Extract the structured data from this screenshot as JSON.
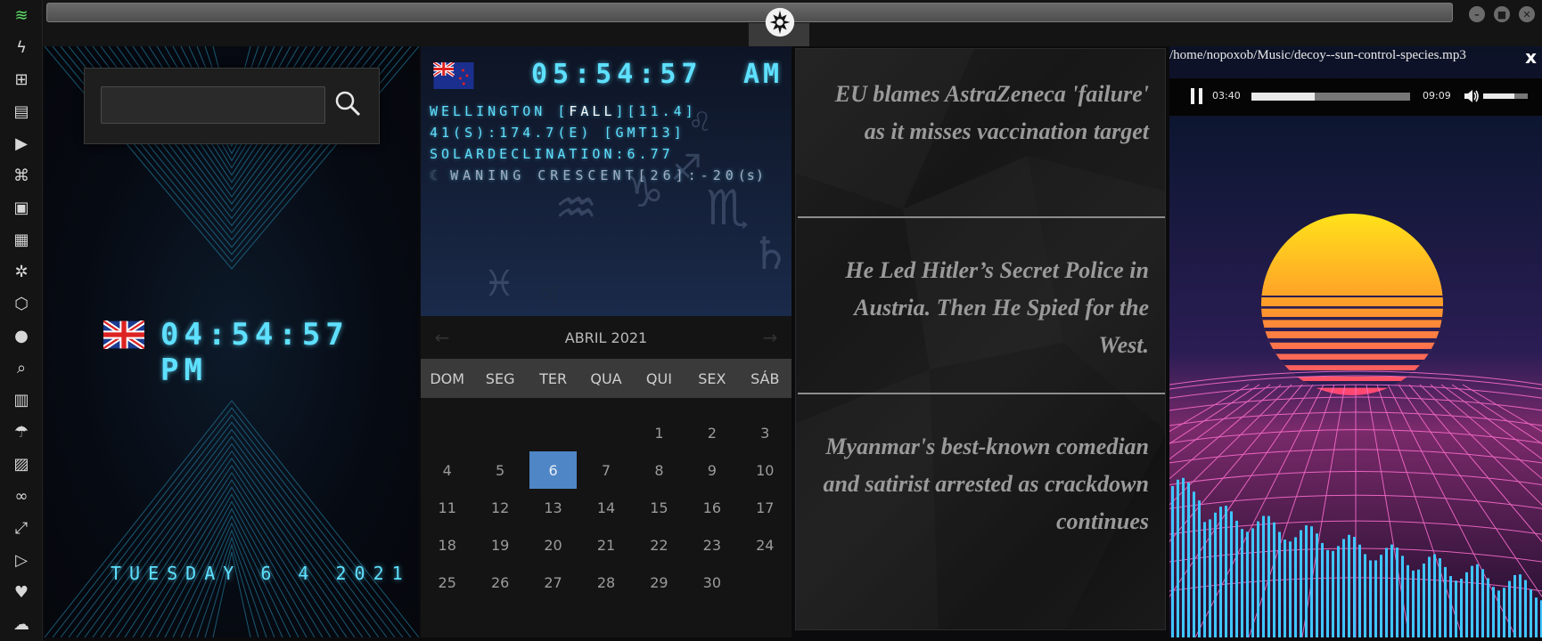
{
  "rail": {
    "icons": [
      "wifi-icon",
      "lightning-icon",
      "windows-icon",
      "archive-icon",
      "play-circle-icon",
      "map-book-icon",
      "image-icon",
      "newspaper-icon",
      "settings-wheel-icon",
      "network-icon",
      "globe-icon",
      "search-icon",
      "map-icon",
      "umbrella-icon",
      "contacts-icon",
      "link-icon",
      "fullscreen-icon",
      "youtube-icon",
      "heart-icon",
      "cloud-icon"
    ]
  },
  "local_clock": {
    "flag": "uk-flag-icon",
    "time": "04:54:57 PM",
    "date": "TUESDAY 6 4 2021"
  },
  "search": {
    "placeholder": ""
  },
  "world_clock": {
    "flag": "nz-flag-icon",
    "time": "05:54:57",
    "ampm": "AM",
    "line1_prefix": "WELLINGTON [",
    "line1_season": "FALL",
    "line1_suffix": "][11.4]",
    "line2": "41(S):174.7(E) [GMT13]",
    "line3": "SOLARDECLINATION:6.77",
    "line4": "WANING CRESCENT[26]:-20",
    "line4_unit": "(s)"
  },
  "calendar": {
    "month": "ABRIL 2021",
    "weekdays": [
      "DOM",
      "SEG",
      "TER",
      "QUA",
      "QUI",
      "SEX",
      "SÁB"
    ],
    "days": [
      "",
      "",
      "",
      "",
      "1",
      "2",
      "3",
      "4",
      "5",
      "6",
      "7",
      "8",
      "9",
      "10",
      "11",
      "12",
      "13",
      "14",
      "15",
      "16",
      "17",
      "18",
      "19",
      "20",
      "21",
      "22",
      "23",
      "24",
      "25",
      "26",
      "27",
      "28",
      "29",
      "30"
    ],
    "today": "6"
  },
  "news": {
    "headlines": [
      "EU blames AstraZeneca 'failure' as it misses vaccination target",
      "He Led Hitler’s Secret Police in Austria. Then He Spied for the West.",
      "Myanmar's best-known comedian and satirist arrested as crackdown continues"
    ]
  },
  "player": {
    "file_path": "/home/nopoxob/Music/decoy--sun-control-species.mp3",
    "close_label": "x",
    "current_time": "03:40",
    "duration": "09:09",
    "progress": 0.4,
    "volume": 0.7,
    "colors": {
      "sun_top": "#ffd21a",
      "sun_bottom": "#ff3f7a",
      "grid": "#ff6fd0",
      "bars": "#3fc6ff"
    }
  }
}
